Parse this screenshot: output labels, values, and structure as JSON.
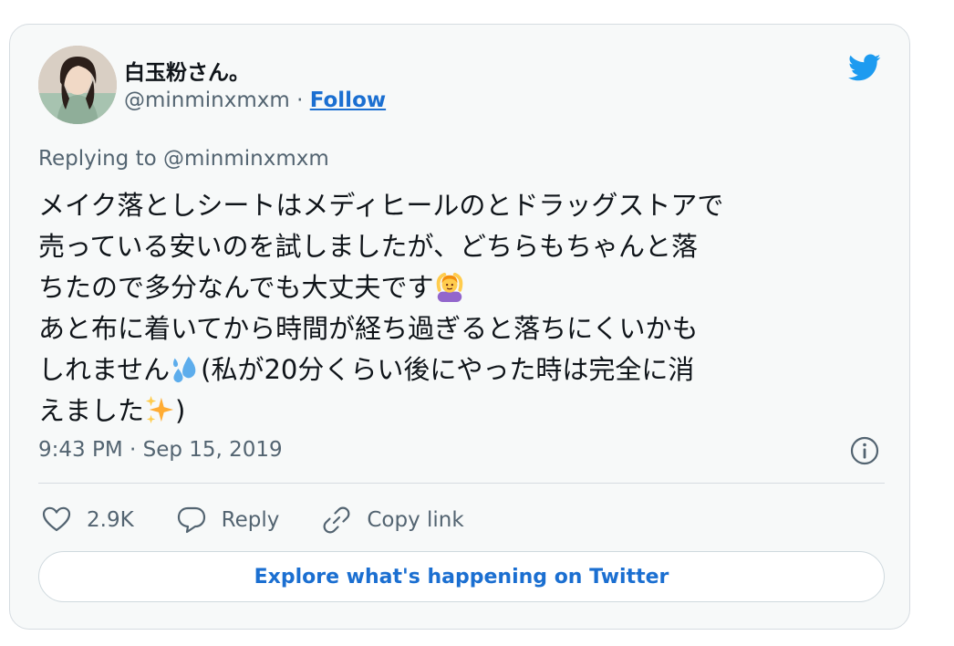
{
  "author": {
    "display_name": "白玉粉さん。",
    "handle": "@minminxmxm",
    "separator": "·",
    "follow_label": "Follow"
  },
  "reply": {
    "replying_to": "Replying to @minminxmxm"
  },
  "tweet": {
    "line1": "メイク落としシートはメディヒールのとドラッグストアで",
    "line2": "売っている安いのを試しましたが、どちらもちゃんと落",
    "line3": "ちたので多分なんでも大丈夫です",
    "line4": "あと布に着いてから時間が経ち過ぎると落ちにくいかも",
    "line5a": "しれません",
    "line5b": "(私が20分くらい後にやった時は完全に消",
    "line6a": "えました",
    "line6b": ")",
    "emojis": [
      "person-gesturing-ok-emoji",
      "sweat-droplets-emoji",
      "sparkles-emoji"
    ]
  },
  "meta": {
    "timestamp": "9:43 PM · Sep 15, 2019"
  },
  "actions": {
    "like_count": "2.9K",
    "reply_label": "Reply",
    "copy_link_label": "Copy link"
  },
  "footer": {
    "explore_label": "Explore what's happening on Twitter"
  },
  "colors": {
    "accent": "#1b6fd1",
    "twitter_blue": "#1d9bf0",
    "text_primary": "#0f1419",
    "text_secondary": "#536471",
    "card_bg": "#f7f9f9",
    "border": "#d6dce1"
  },
  "icons": [
    "twitter-bird-icon",
    "info-icon",
    "heart-icon",
    "reply-bubble-icon",
    "link-icon"
  ]
}
